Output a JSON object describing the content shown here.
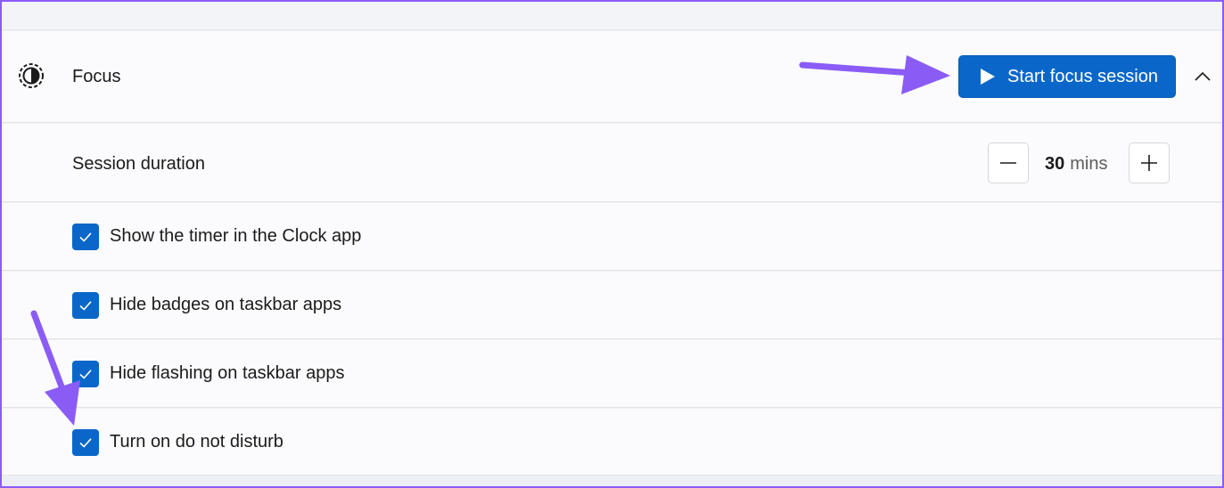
{
  "focus": {
    "title": "Focus",
    "start_button_label": "Start focus session",
    "icon": "focus-icon",
    "collapse_icon": "chevron-up-icon"
  },
  "session": {
    "label": "Session duration",
    "value": "30",
    "unit": "mins",
    "decrement_icon": "minus-icon",
    "increment_icon": "plus-icon"
  },
  "options": [
    {
      "label": "Show the timer in the Clock app",
      "checked": true
    },
    {
      "label": "Hide badges on taskbar apps",
      "checked": true
    },
    {
      "label": "Hide flashing on taskbar apps",
      "checked": true
    },
    {
      "label": "Turn on do not disturb",
      "checked": true
    }
  ],
  "colors": {
    "accent": "#0a67c9",
    "annotation_arrow": "#8a5cf5",
    "panel_bg": "#fbfbfd"
  }
}
